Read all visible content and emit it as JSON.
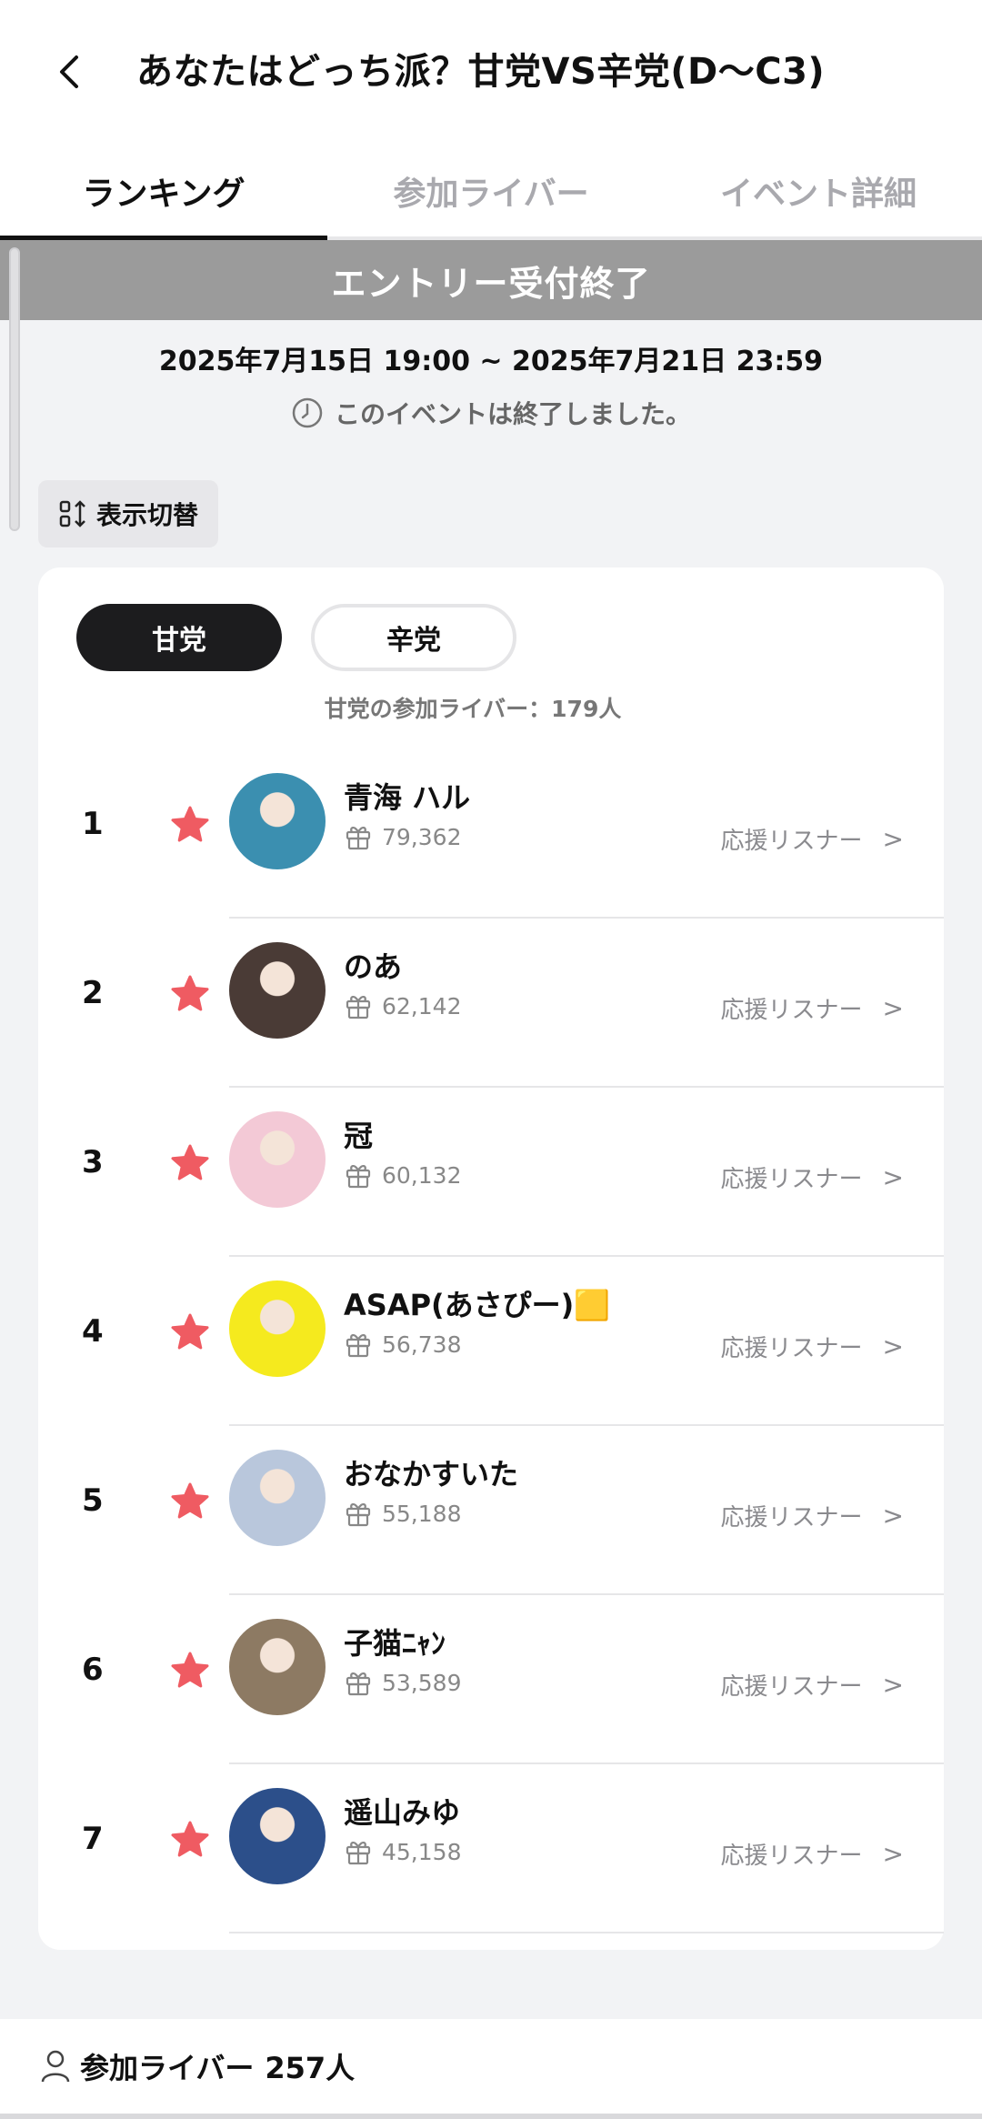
{
  "header": {
    "title": "あなたはどっち派？甘党VS辛党(D〜C3)"
  },
  "tabs": [
    {
      "label": "ランキング",
      "active": true
    },
    {
      "label": "参加ライバー",
      "active": false
    },
    {
      "label": "イベント詳細",
      "active": false
    }
  ],
  "banner": "エントリー受付終了",
  "period": "2025年7月15日 19:00 ~ 2025年7月21日 23:59",
  "status": "このイベントは終了しました。",
  "toggle_view_label": "表示切替",
  "party": {
    "sweet_label": "甘党",
    "spicy_label": "辛党",
    "count_text": "甘党の参加ライバー：179人"
  },
  "ranking": [
    {
      "rank": "1",
      "name": "青海 ハル",
      "points": "79,362",
      "support": "応援リスナー",
      "chevron": ">",
      "avatar_color": "#3b8fb0"
    },
    {
      "rank": "2",
      "name": "のあ",
      "points": "62,142",
      "support": "応援リスナー",
      "chevron": ">",
      "avatar_color": "#4a3b36"
    },
    {
      "rank": "3",
      "name": "冠",
      "points": "60,132",
      "support": "応援リスナー",
      "chevron": ">",
      "avatar_color": "#f3c9d6"
    },
    {
      "rank": "4",
      "name": "ASAP(あさぴー)🟨",
      "points": "56,738",
      "support": "応援リスナー",
      "chevron": ">",
      "avatar_color": "#f5ea1e"
    },
    {
      "rank": "5",
      "name": "おなかすいた",
      "points": "55,188",
      "support": "応援リスナー",
      "chevron": ">",
      "avatar_color": "#b9c7dc"
    },
    {
      "rank": "6",
      "name": "子猫ﾆｬﾝ",
      "points": "53,589",
      "support": "応援リスナー",
      "chevron": ">",
      "avatar_color": "#8d7a63"
    },
    {
      "rank": "7",
      "name": "遥山みゆ",
      "points": "45,158",
      "support": "応援リスナー",
      "chevron": ">",
      "avatar_color": "#2c4f8a"
    }
  ],
  "footer": {
    "label": "参加ライバー",
    "count": "257人"
  },
  "colors": {
    "star": "#ef5b62",
    "banner": "#9b9b9b",
    "active_pill": "#1c1c1e"
  }
}
